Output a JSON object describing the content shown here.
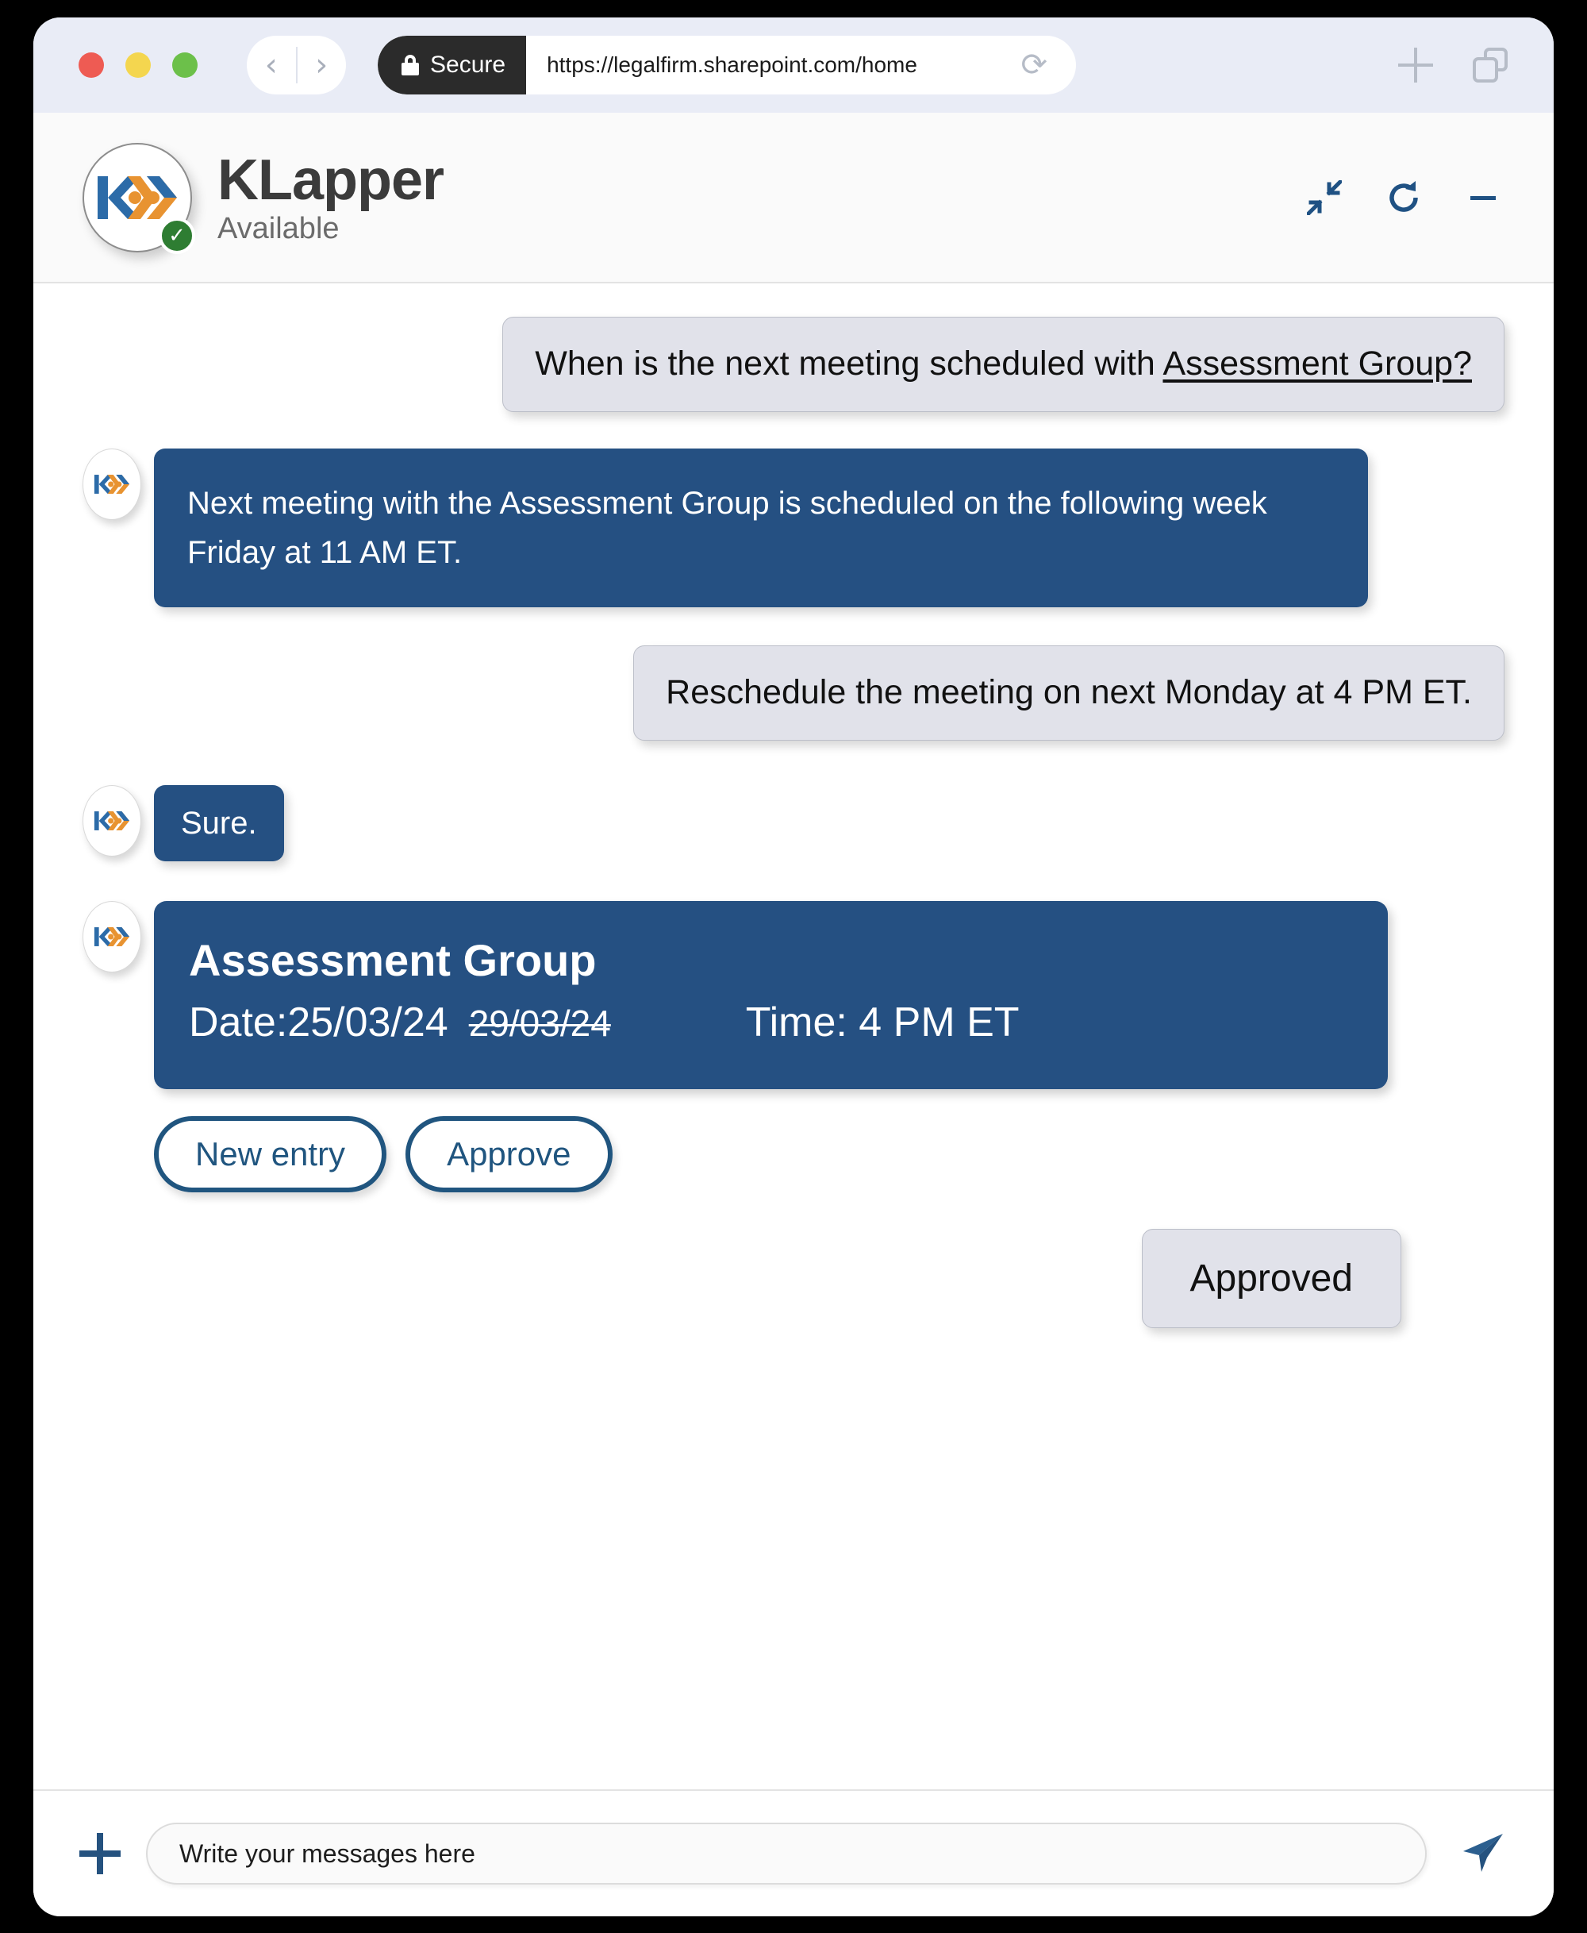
{
  "browser": {
    "traffic_lights": [
      "close",
      "minimize",
      "zoom"
    ],
    "back_label": "‹",
    "forward_label": "›",
    "secure_label": "Secure",
    "url": "https://legalfirm.sharepoint.com/home",
    "reload_label": "⟳",
    "new_tab_label": "new-tab",
    "tabs_label": "tabs"
  },
  "app": {
    "title": "KLapper",
    "status": "Available",
    "status_check": "✓",
    "actions": [
      {
        "name": "collapse",
        "label": "collapse"
      },
      {
        "name": "refresh",
        "label": "refresh"
      },
      {
        "name": "minimize",
        "label": "minimize"
      }
    ]
  },
  "chat": {
    "msg1_prefix": "When is the next meeting scheduled with ",
    "msg1_link": "Assessment Group?",
    "msg2": "Next meeting with the Assessment Group is scheduled on the following week Friday at 11 AM ET.",
    "msg3": "Reschedule the meeting on next Monday at 4 PM ET.",
    "msg4": "Sure.",
    "card": {
      "title": "Assessment Group",
      "date_label": "Date: ",
      "date_new": "25/03/24",
      "date_old": "29/03/24",
      "time": "Time: 4 PM ET"
    },
    "buttons": {
      "new_entry": "New entry",
      "approve": "Approve"
    },
    "msg5": "Approved"
  },
  "composer": {
    "add_label": "add-attachment",
    "placeholder": "Write your messages here",
    "send_label": "send"
  },
  "colors": {
    "brand_blue": "#255082",
    "brand_orange": "#e89331",
    "logo_blue": "#2c6ba8",
    "bubble_gray": "#e1e2ea",
    "chrome_bg": "#e9ecf6",
    "status_green": "#2e7d32"
  }
}
